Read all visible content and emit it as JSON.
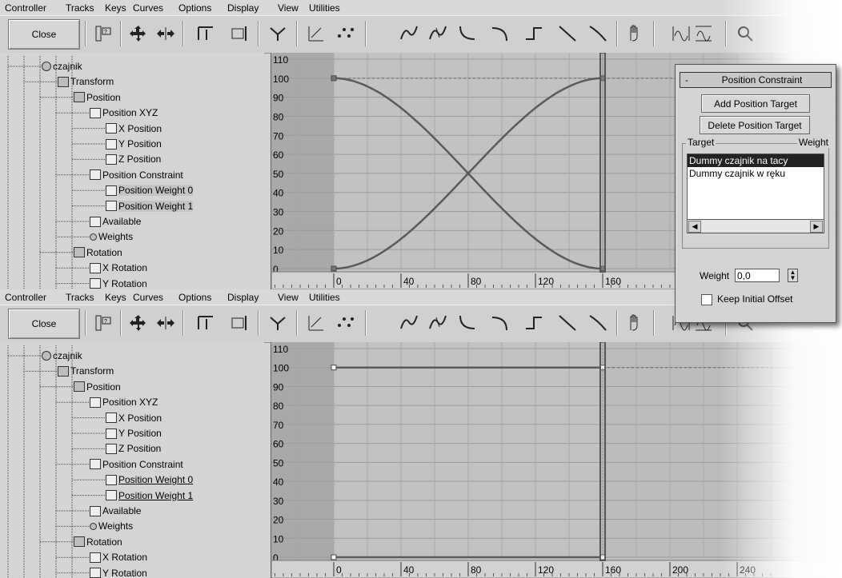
{
  "menu": [
    "Controller",
    "Tracks",
    "Keys",
    "Curves",
    "Options",
    "Display",
    "View",
    "Utilities"
  ],
  "toolbar": {
    "close_label": "Close"
  },
  "tree": [
    {
      "label": "czajnik",
      "icon": "teapot-icon",
      "level": 0
    },
    {
      "label": "Transform",
      "icon": "transform-icon",
      "level": 1
    },
    {
      "label": "Position",
      "icon": "position-list-icon",
      "level": 2
    },
    {
      "label": "Position XYZ",
      "icon": "position-xyz-icon",
      "level": 3
    },
    {
      "label": "X Position",
      "icon": "curve-icon",
      "level": 4
    },
    {
      "label": "Y Position",
      "icon": "curve-icon",
      "level": 4
    },
    {
      "label": "Z Position",
      "icon": "curve-icon",
      "level": 4
    },
    {
      "label": "Position Constraint",
      "icon": "constraint-lock-icon",
      "level": 3
    },
    {
      "label": "Position Weight 0",
      "icon": "curve-icon",
      "level": 4,
      "highlight": true
    },
    {
      "label": "Position Weight 1",
      "icon": "curve-icon",
      "level": 4,
      "highlight": true
    },
    {
      "label": "Available",
      "icon": "position-xyz-icon",
      "level": 3
    },
    {
      "label": "Weights",
      "icon": "expand-plus-icon",
      "level": 3
    },
    {
      "label": "Rotation",
      "icon": "rotation-icon",
      "level": 2
    },
    {
      "label": "X Rotation",
      "icon": "curve-icon",
      "level": 3
    },
    {
      "label": "Y Rotation",
      "icon": "curve-icon",
      "level": 3
    }
  ],
  "graph": {
    "y_ticks": [
      "110",
      "100",
      "90",
      "80",
      "70",
      "60",
      "50",
      "40",
      "30",
      "20",
      "10",
      "0"
    ],
    "x_ticks_top": [
      "0",
      "40",
      "80",
      "120",
      "160"
    ],
    "x_ticks_bottom": [
      "0",
      "40",
      "80",
      "120",
      "160",
      "200",
      "240"
    ]
  },
  "chart_data": [
    {
      "type": "line",
      "title": "",
      "series": [
        {
          "name": "",
          "x": [
            0,
            20,
            40,
            60,
            80,
            100,
            120,
            140,
            160
          ],
          "values": [
            100,
            96,
            85,
            69,
            50,
            31,
            15,
            4,
            0
          ]
        },
        {
          "name": "",
          "x": [
            0,
            20,
            40,
            60,
            80,
            100,
            120,
            140,
            160
          ],
          "values": [
            0,
            4,
            15,
            31,
            50,
            69,
            85,
            96,
            100
          ]
        }
      ],
      "xlim": [
        -40,
        240
      ],
      "ylim": [
        0,
        110
      ]
    },
    {
      "type": "line",
      "title": "",
      "series": [
        {
          "name": "",
          "x": [
            0,
            160
          ],
          "values": [
            100,
            100
          ]
        },
        {
          "name": "",
          "x": [
            0,
            160
          ],
          "values": [
            0,
            0
          ]
        }
      ],
      "xlim": [
        -40,
        240
      ],
      "ylim": [
        0,
        110
      ]
    }
  ],
  "panel": {
    "title": "Position Constraint",
    "collapse": "-",
    "add_target": "Add Position Target",
    "delete_target": "Delete Position Target",
    "col_target": "Target",
    "col_weight": "Weight",
    "targets": [
      "Dummy czajnik na tacy",
      "Dummy czajnik w ręku"
    ],
    "weight_label": "Weight",
    "weight_value": "0,0",
    "keep_offset": "Keep Initial Offset"
  }
}
